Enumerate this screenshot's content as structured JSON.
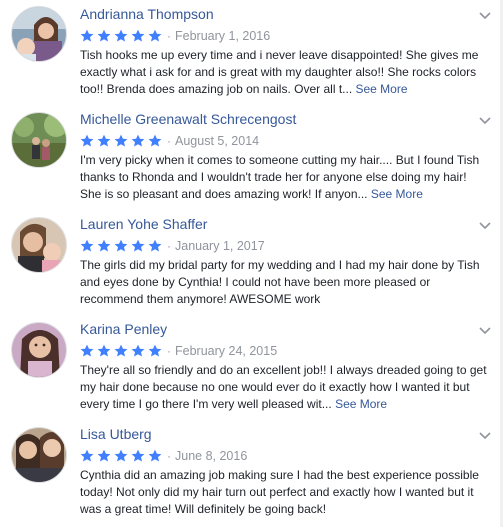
{
  "see_more_label": "See More",
  "dot": "·",
  "colors": {
    "star": "#4080ff",
    "link": "#365899",
    "muted": "#90949c"
  },
  "reviews": [
    {
      "name": "Andrianna Thompson",
      "rating": 5,
      "date": "February 1, 2016",
      "text": "Tish hooks me up every time and i never leave disappointed! She gives me exactly what i ask for and is great with my daughter also!! She rocks colors too!! Brenda does amazing job on nails. Over all t...",
      "has_see_more": true
    },
    {
      "name": "Michelle Greenawalt Schrecengost",
      "rating": 5,
      "date": "August 5, 2014",
      "text": "I'm very picky when it comes to someone cutting my hair.... But I found Tish thanks to Rhonda and I wouldn't trade her for anyone else doing my hair! She is so pleasant and does amazing work! If anyon...",
      "has_see_more": true
    },
    {
      "name": "Lauren Yohe Shaffer",
      "rating": 5,
      "date": "January 1, 2017",
      "text": "The girls did my bridal party for my wedding and I had my hair done by Tish and eyes done by Cynthia! I could not have been more pleased or recommend them anymore! AWESOME work",
      "has_see_more": false
    },
    {
      "name": "Karina Penley",
      "rating": 5,
      "date": "February 24, 2015",
      "text": "They're all so friendly and do an excellent job!! I always dreaded going to get my hair done because no one would ever do it exactly how I wanted it but every time I go there I'm very well pleased wit...",
      "has_see_more": true
    },
    {
      "name": "Lisa Utberg",
      "rating": 5,
      "date": "June 8, 2016",
      "text": "Cynthia did an amazing job making sure I had the best experience possible today! Not only did my hair turn out perfect and exactly how I wanted but it was a great time! Will definitely be going back!",
      "has_see_more": false
    }
  ]
}
